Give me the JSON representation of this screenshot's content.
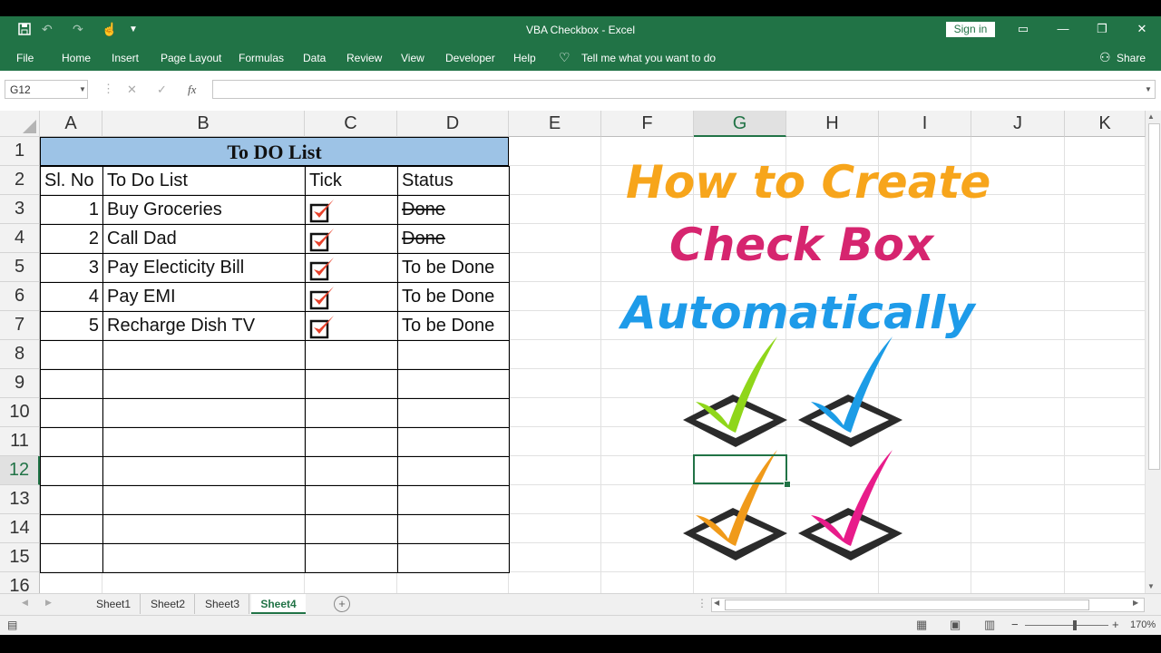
{
  "app": {
    "title": "VBA Checkbox  -  Excel",
    "sign_in": "Sign in",
    "brand_color": "#217346"
  },
  "ribbon": {
    "tabs": [
      "File",
      "Home",
      "Insert",
      "Page Layout",
      "Formulas",
      "Data",
      "Review",
      "View",
      "Developer",
      "Help"
    ],
    "tell_me": "Tell me what you want to do",
    "share": "Share"
  },
  "formula_bar": {
    "name_box": "G12",
    "fx": "fx",
    "content": ""
  },
  "grid": {
    "columns": [
      "A",
      "B",
      "C",
      "D",
      "E",
      "F",
      "G",
      "H",
      "I",
      "J",
      "K"
    ],
    "selected_column": "G",
    "rows": [
      "1",
      "2",
      "3",
      "4",
      "5",
      "6",
      "7",
      "8",
      "9",
      "10",
      "11",
      "12",
      "13",
      "14",
      "15",
      "16"
    ],
    "selected_row": "12",
    "selected_cell": "G12"
  },
  "table": {
    "title": "To DO List",
    "title_fill": "#9dc3e6",
    "headers": [
      "Sl. No",
      "To Do List",
      "Tick",
      "Status"
    ],
    "rows": [
      {
        "sl": "1",
        "task": "Buy Groceries",
        "checked": true,
        "status": "Done",
        "strike": true
      },
      {
        "sl": "2",
        "task": "Call Dad",
        "checked": true,
        "status": "Done",
        "strike": true
      },
      {
        "sl": "3",
        "task": "Pay Electicity Bill",
        "checked": true,
        "status": "To be Done",
        "strike": false
      },
      {
        "sl": "4",
        "task": "Pay EMI",
        "checked": true,
        "status": "To be Done",
        "strike": false
      },
      {
        "sl": "5",
        "task": "Recharge Dish TV",
        "checked": true,
        "status": "To be Done",
        "strike": false
      }
    ]
  },
  "headline": {
    "line1": "How to Create",
    "line1_color": "#f7a51b",
    "line2": "Check Box",
    "line2_color": "#d6256f",
    "line3": "Automatically",
    "line3_color": "#1e9be9"
  },
  "graphic": {
    "checkmark_colors": [
      "#8fd61a",
      "#1c9ce6",
      "#f09a1a",
      "#e81c8a"
    ]
  },
  "sheets": {
    "tabs": [
      "Sheet1",
      "Sheet2",
      "Sheet3",
      "Sheet4"
    ],
    "active": "Sheet4"
  },
  "status": {
    "zoom": "170%"
  }
}
